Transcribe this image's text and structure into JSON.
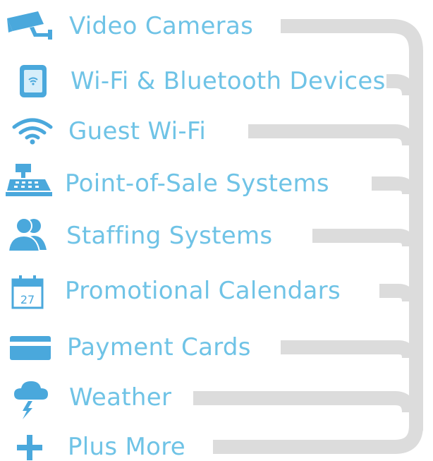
{
  "items": [
    {
      "label": "Video Cameras",
      "icon": "security-camera-icon"
    },
    {
      "label": "Wi-Fi & Bluetooth Devices",
      "icon": "tablet-icon"
    },
    {
      "label": "Guest Wi-Fi",
      "icon": "wifi-icon"
    },
    {
      "label": "Point-of-Sale Systems",
      "icon": "cash-register-icon"
    },
    {
      "label": "Staffing Systems",
      "icon": "people-icon"
    },
    {
      "label": "Promotional Calendars",
      "icon": "calendar-icon",
      "icon_text": "27"
    },
    {
      "label": "Payment Cards",
      "icon": "credit-card-icon"
    },
    {
      "label": "Weather",
      "icon": "storm-cloud-icon"
    },
    {
      "label": "Plus More",
      "icon": "plus-icon"
    }
  ],
  "colors": {
    "icon": "#4aa8dc",
    "text": "#6fc3e6",
    "connector": "#dcdcdc"
  }
}
